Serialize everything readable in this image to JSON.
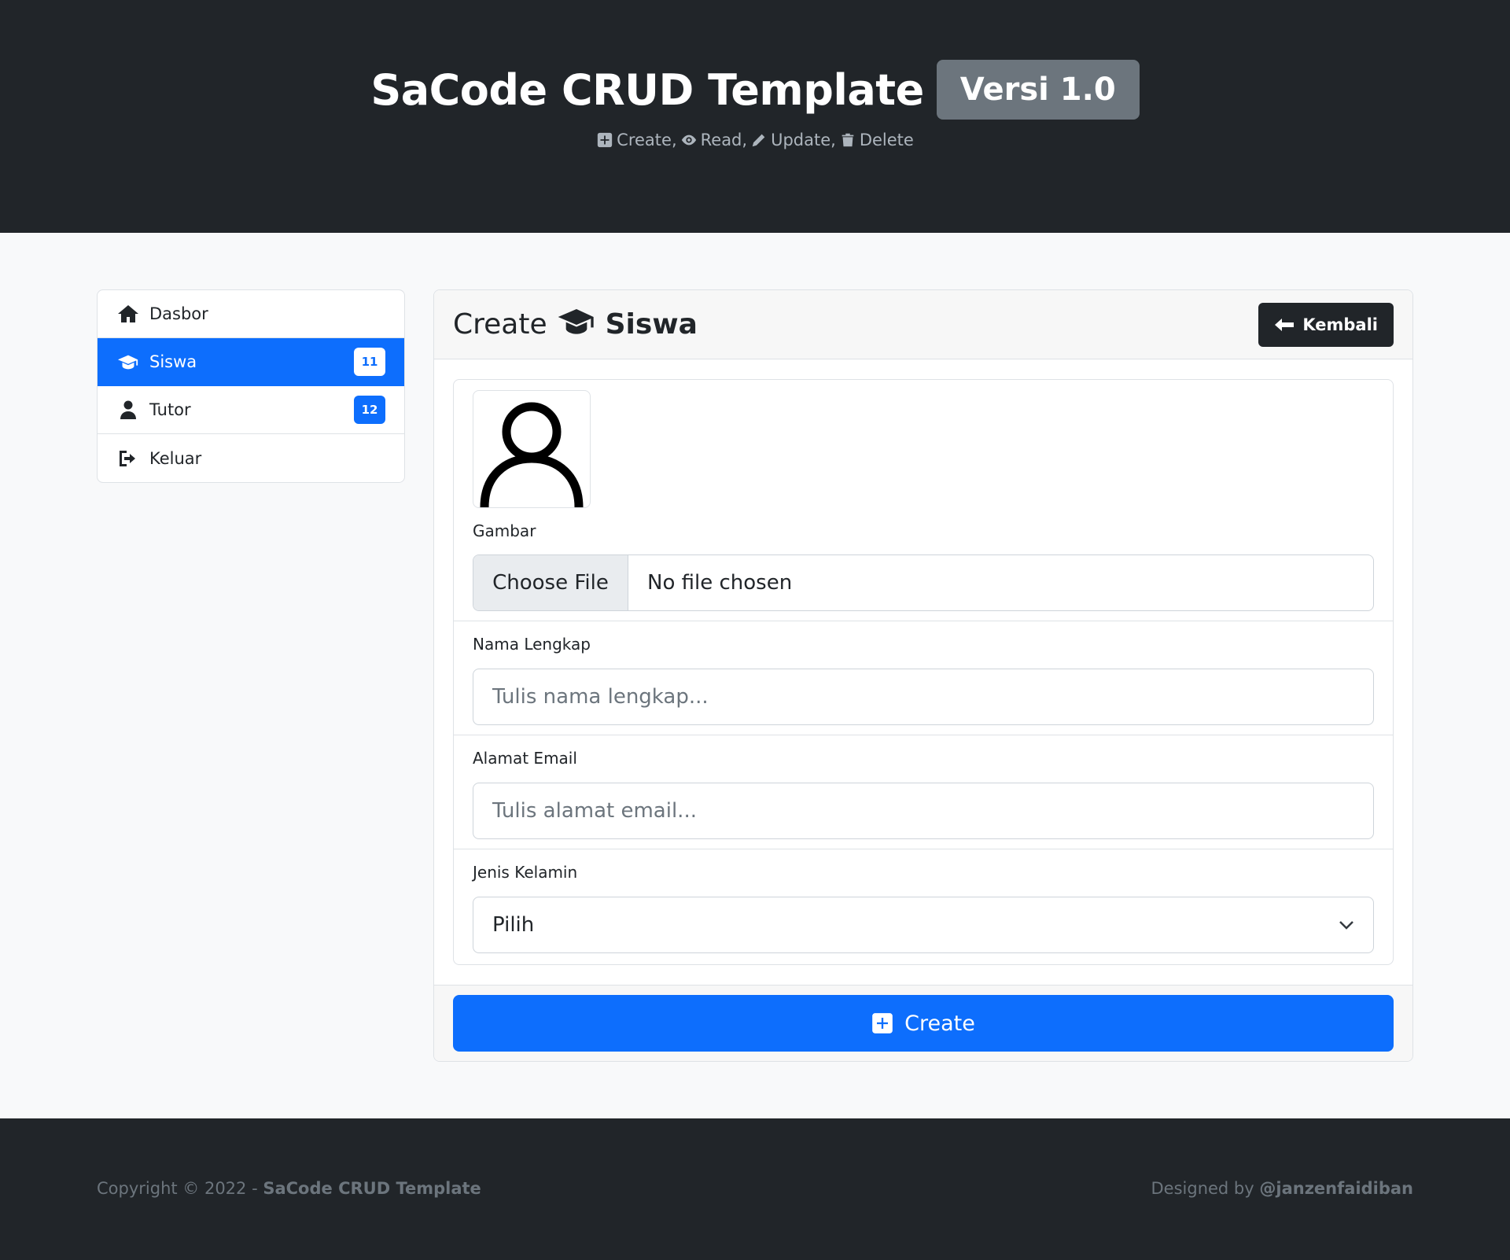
{
  "header": {
    "title": "SaCode CRUD Template",
    "version": "Versi 1.0",
    "crud": {
      "create": "Create,",
      "read": "Read,",
      "update": "Update,",
      "delete": "Delete"
    }
  },
  "sidebar": {
    "items": [
      {
        "label": "Dasbor",
        "icon": "home-icon"
      },
      {
        "label": "Siswa",
        "icon": "graduation-cap-icon",
        "badge": "11",
        "active": true
      },
      {
        "label": "Tutor",
        "icon": "user-tie-icon",
        "badge": "12"
      },
      {
        "label": "Keluar",
        "icon": "sign-out-icon"
      }
    ]
  },
  "card": {
    "title_prefix": "Create",
    "title_entity": "Siswa",
    "back_label": "Kembali"
  },
  "form": {
    "image_label": "Gambar",
    "file_button": "Choose File",
    "file_status": "No file chosen",
    "name_label": "Nama Lengkap",
    "name_placeholder": "Tulis nama lengkap...",
    "email_label": "Alamat Email",
    "email_placeholder": "Tulis alamat email...",
    "gender_label": "Jenis Kelamin",
    "gender_selected": "Pilih",
    "submit_label": "Create"
  },
  "footer": {
    "copyright_prefix": "Copyright © 2022 - ",
    "copyright_brand": "SaCode CRUD Template",
    "designed_prefix": "Designed by ",
    "designed_by": "@janzenfaidiban"
  },
  "colors": {
    "primary": "#0d6efd",
    "dark": "#212529",
    "secondary": "#6c757d"
  }
}
